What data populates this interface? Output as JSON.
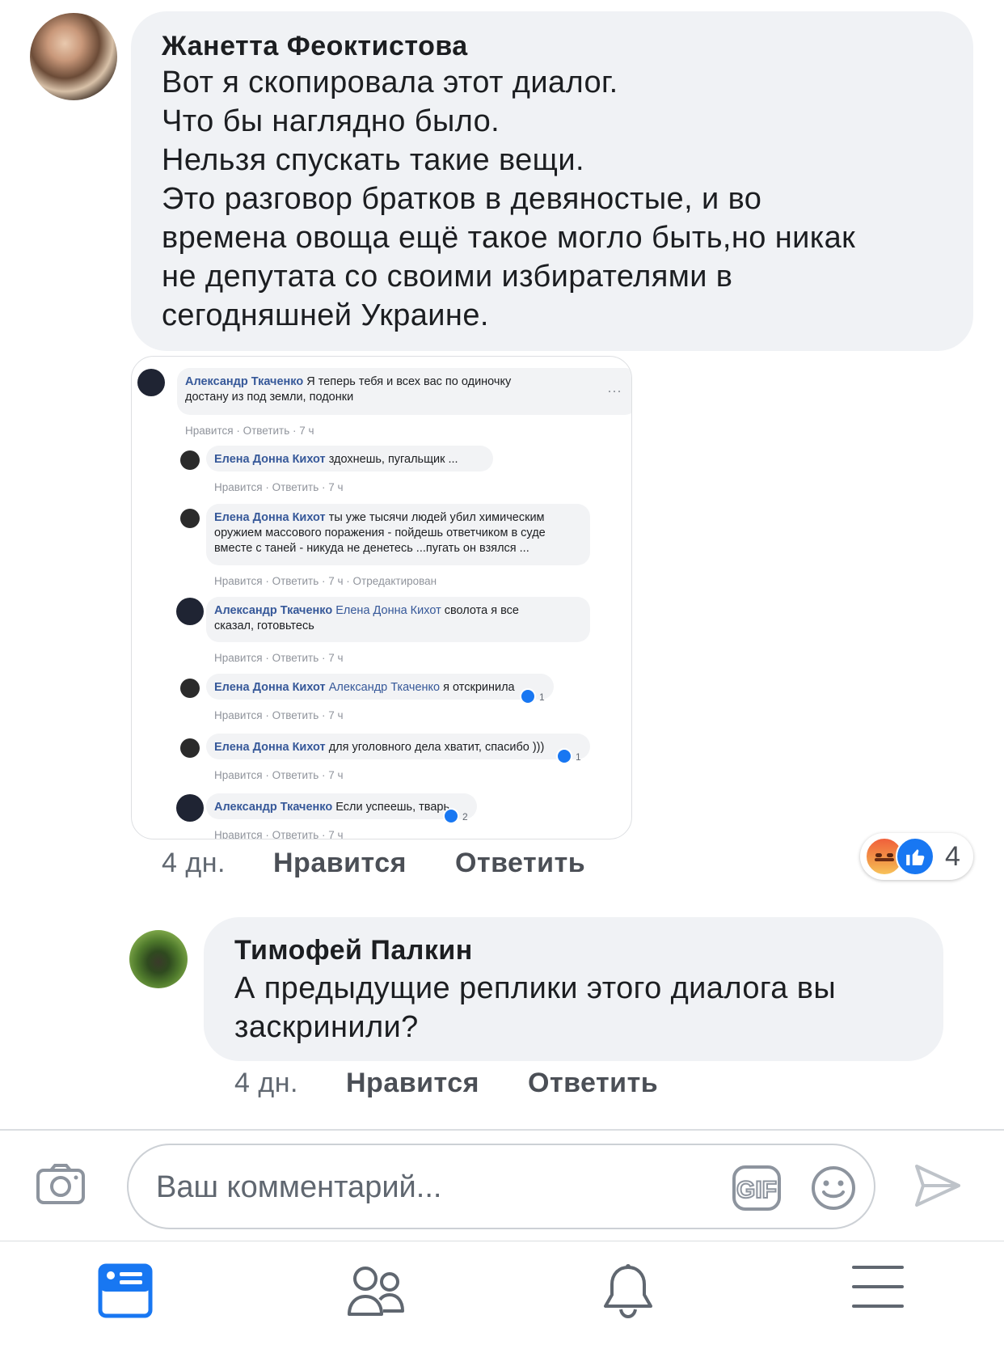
{
  "comments": [
    {
      "author": "Жанетта Феоктистова",
      "text": "Вот я скопировала этот диалог.\nЧто бы наглядно было.\nНельзя спускать такие вещи.\nЭто разговор братков в девяностые, и во\nвремена овоща ещё такое могло быть,но никак\nне депутата со своими избирателями в\nсегодняшней Украине.",
      "time": "4 дн.",
      "like_label": "Нравится",
      "reply_label": "Ответить",
      "reaction_count": "4",
      "reactions": [
        "angry-icon",
        "like-icon"
      ]
    },
    {
      "author": "Тимофей Палкин",
      "text": "А предыдущие реплики этого диалога вы\nзаскринили?",
      "time": "4 дн.",
      "like_label": "Нравится",
      "reply_label": "Ответить"
    }
  ],
  "screenshot": {
    "meta_like": "Нравится",
    "meta_reply": "Ответить",
    "meta_time": "7 ч",
    "meta_edited": "Отредактирован",
    "items": [
      {
        "author": "Александр Ткаченко",
        "lines": [
          "Я теперь тебя и всех вас по одиночку",
          "достану из под земли, подонки"
        ],
        "edited": false,
        "reaction": ""
      },
      {
        "author": "Елена Донна Кихот",
        "lines": [
          "здохнешь, пугальщик ..."
        ],
        "edited": false,
        "reaction": ""
      },
      {
        "author": "Елена Донна Кихот",
        "lines": [
          "ты уже тысячи людей убил химическим",
          "оружием массового поражения - пойдешь ответчиком в суде",
          "вместе с таней - никуда не денетесь ...пугать он взялся ..."
        ],
        "edited": true,
        "reaction": ""
      },
      {
        "author": "Александр Ткаченко",
        "mention": "Елена Донна Кихот",
        "lines": [
          "сволота я все",
          "сказал, готовьтесь"
        ],
        "edited": false,
        "reaction": ""
      },
      {
        "author": "Елена Донна Кихот",
        "mention": "Александр Ткаченко",
        "lines": [
          "я отскринила"
        ],
        "edited": false,
        "reaction": "1"
      },
      {
        "author": "Елена Донна Кихот",
        "lines": [
          "для уголовного дела хватит, спасибо )))"
        ],
        "edited": false,
        "reaction": "1"
      },
      {
        "author": "Александр Ткаченко",
        "lines": [
          "Если успеешь, тварь"
        ],
        "edited": false,
        "reaction": "2"
      }
    ]
  },
  "composer": {
    "placeholder": "Ваш комментарий...",
    "gif_label": "GIF"
  },
  "colors": {
    "bubble": "#f0f2f5",
    "link": "#365899",
    "like_blue": "#1877f2",
    "tab_active": "#1877f2",
    "muted": "#606770"
  }
}
